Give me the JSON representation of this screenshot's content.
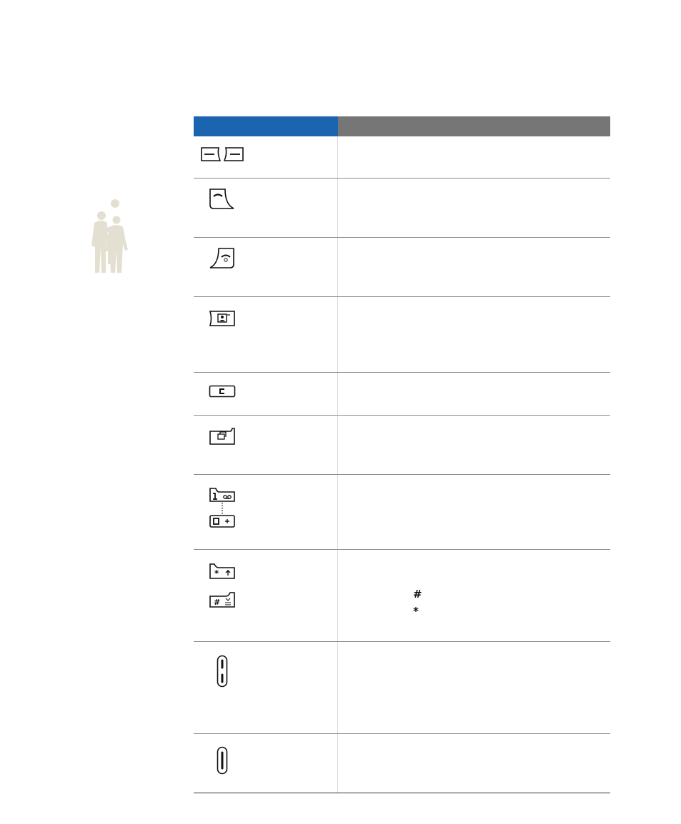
{
  "rows": [
    {
      "key_icon": "soft-keys-icon",
      "functions": ""
    },
    {
      "key_icon": "dial-key-icon",
      "functions": ""
    },
    {
      "key_icon": "power-end-key-icon",
      "functions": ""
    },
    {
      "key_icon": "camera-key-icon",
      "functions": ""
    },
    {
      "key_icon": "clear-key-icon",
      "functions": ""
    },
    {
      "key_icon": "web-access-key-icon",
      "functions": ""
    },
    {
      "key_icon": "alphanumeric-keys-icon",
      "functions": ""
    },
    {
      "key_icon": "special-function-keys-icon",
      "functions": ""
    },
    {
      "key_icon": "volume-keys-icon",
      "functions": ""
    },
    {
      "key_icon": "side-key-icon",
      "functions": ""
    }
  ],
  "special_symbols": {
    "hash": "#",
    "star": "*"
  },
  "colors": {
    "header_key": "#1b64b0",
    "header_function": "#767676",
    "figure": "#e3e0d2"
  }
}
